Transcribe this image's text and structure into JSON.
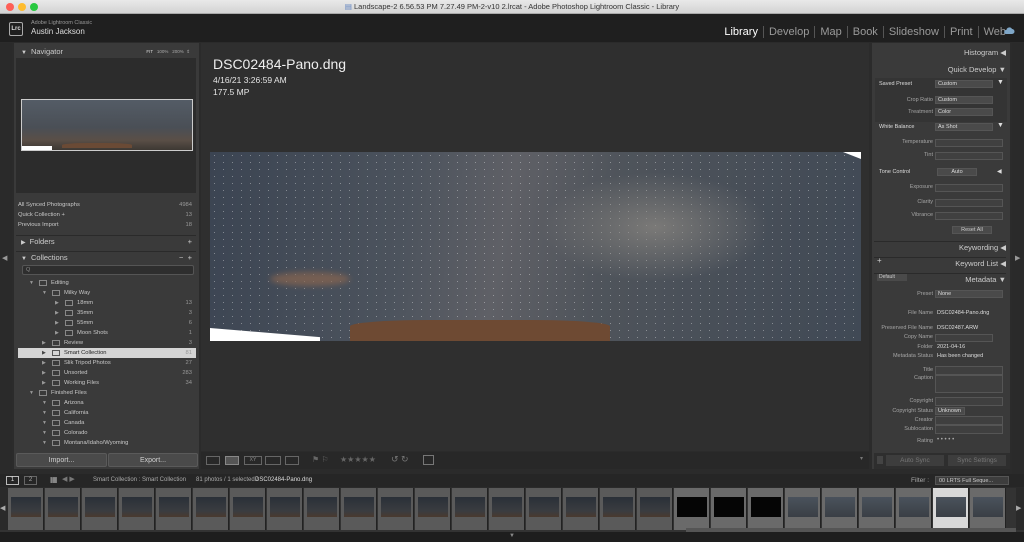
{
  "window": {
    "title": "Landscape-2 6.56.53 PM 7.27.49 PM-2-v10 2.lrcat - Adobe Photoshop Lightroom Classic - Library"
  },
  "brand": {
    "logo": "Lrc",
    "app": "Adobe Lightroom Classic",
    "user": "Austin Jackson"
  },
  "modules": [
    "Library",
    "Develop",
    "Map",
    "Book",
    "Slideshow",
    "Print",
    "Web"
  ],
  "navigator": {
    "title": "Navigator",
    "zoom": [
      "FIT",
      "100%",
      "200%"
    ]
  },
  "catalog": [
    {
      "label": "All Synced Photographs",
      "count": "4984"
    },
    {
      "label": "Quick Collection  +",
      "count": "13"
    },
    {
      "label": "Previous Import",
      "count": "18"
    }
  ],
  "folders": {
    "title": "Folders"
  },
  "collections": {
    "title": "Collections",
    "filter_placeholder": "Q",
    "items": [
      {
        "label": "Editing",
        "count": "",
        "indent": 1
      },
      {
        "label": "Milky Way",
        "count": "",
        "indent": 2
      },
      {
        "label": "18mm",
        "count": "13",
        "indent": 3
      },
      {
        "label": "35mm",
        "count": "3",
        "indent": 3
      },
      {
        "label": "55mm",
        "count": "6",
        "indent": 3
      },
      {
        "label": "Moon Shots",
        "count": "1",
        "indent": 3
      },
      {
        "label": "Review",
        "count": "3",
        "indent": 2
      },
      {
        "label": "Smart Collection",
        "count": "81",
        "indent": 2,
        "selected": true
      },
      {
        "label": "Slik Tripod Photos",
        "count": "27",
        "indent": 2
      },
      {
        "label": "Unsorted",
        "count": "283",
        "indent": 2
      },
      {
        "label": "Working Files",
        "count": "34",
        "indent": 2
      },
      {
        "label": "Finished Files",
        "count": "",
        "indent": 1
      },
      {
        "label": "Arizona",
        "count": "",
        "indent": 2
      },
      {
        "label": "California",
        "count": "",
        "indent": 2
      },
      {
        "label": "Canada",
        "count": "",
        "indent": 2
      },
      {
        "label": "Colorado",
        "count": "",
        "indent": 2
      },
      {
        "label": "Montana/Idaho/Wyoming",
        "count": "",
        "indent": 2
      }
    ]
  },
  "left_buttons": {
    "import": "Import...",
    "export": "Export..."
  },
  "photo": {
    "filename": "DSC02484-Pano.dng",
    "date": "4/16/21 3:26:59 AM",
    "megapixels": "177.5 MP"
  },
  "right": {
    "histogram": "Histogram",
    "quick_develop": "Quick Develop",
    "saved_preset": {
      "label": "Saved Preset",
      "value": "Custom"
    },
    "crop_ratio": {
      "label": "Crop Ratio",
      "value": "Custom"
    },
    "treatment": {
      "label": "Treatment",
      "value": "Color"
    },
    "white_balance": {
      "label": "White Balance",
      "value": "As Shot"
    },
    "temperature": "Temperature",
    "tint": "Tint",
    "tone_control": {
      "label": "Tone Control",
      "value": "Auto"
    },
    "exposure": "Exposure",
    "clarity": "Clarity",
    "vibrance": "Vibrance",
    "reset_all": "Reset All",
    "keywording": "Keywording",
    "keyword_list": "Keyword List",
    "metadata": "Metadata",
    "metadata_view": "Default",
    "preset": {
      "label": "Preset",
      "value": "None"
    },
    "file_name": {
      "label": "File Name",
      "value": "DSC02484-Pano.dng"
    },
    "preserved_file_name": {
      "label": "Preserved File Name",
      "value": "DSC02487.ARW"
    },
    "copy_name": {
      "label": "Copy Name",
      "value": ""
    },
    "folder": {
      "label": "Folder",
      "value": "2021-04-16"
    },
    "metadata_status": {
      "label": "Metadata Status",
      "value": "Has been changed"
    },
    "title": "Title",
    "caption": "Caption",
    "copyright": "Copyright",
    "copyright_status": {
      "label": "Copyright Status",
      "value": "Unknown"
    },
    "creator": "Creator",
    "sublocation": "Sublocation",
    "rating": {
      "label": "Rating",
      "value": "• • • • •"
    },
    "auto_sync": "Auto Sync",
    "sync_settings": "Sync Settings"
  },
  "filmstrip_bar": {
    "screen1": "1",
    "screen2": "2",
    "source": "Smart Collection : Smart Collection",
    "counts": "81 photos / 1 selected /",
    "selected_file": "DSC02484-Pano.dng",
    "filter_label": "Filter :",
    "filter_value": "00 LRTS Full Seque..."
  },
  "filmstrip": {
    "cells": 27,
    "selected_index": 25
  },
  "colors": {
    "accent_selected": "#d5d5d5",
    "panel": "#3a3a3a",
    "background": "#2b2b2b"
  }
}
